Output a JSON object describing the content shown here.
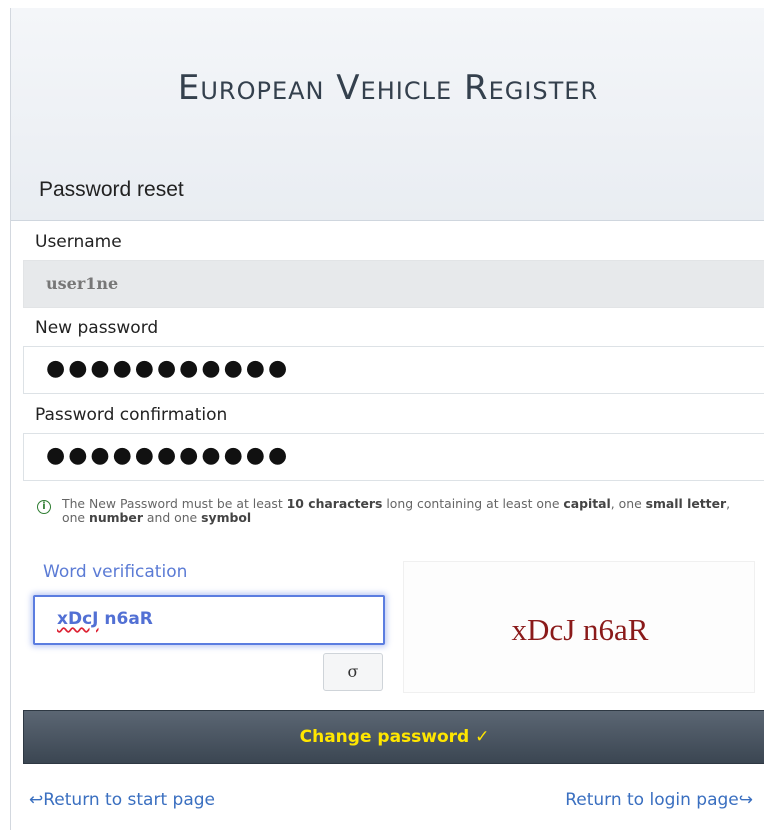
{
  "header": {
    "site_title": "European Vehicle Register"
  },
  "form": {
    "title": "Password reset",
    "username": {
      "label": "Username",
      "value": "user1ne"
    },
    "new_password": {
      "label": "New password",
      "masked_value": "●●●●●●●●●●●"
    },
    "password_confirmation": {
      "label": "Password confirmation",
      "masked_value": "●●●●●●●●●●●"
    },
    "info": {
      "icon": "info-circle-icon",
      "text_1": "The New Password must be at least ",
      "bold_1": "10 characters",
      "text_2": " long containing at least one ",
      "bold_2": "capital",
      "text_3": ", one ",
      "bold_3": "small letter",
      "text_4": ", one ",
      "bold_4": "number",
      "text_5": " and one ",
      "bold_5": "symbol"
    },
    "verification": {
      "label": "Word verification",
      "input_value_part1": "xDcJ",
      "input_value_part2": " n6aR",
      "captcha_text": "xDcJ n6aR",
      "refresh_symbol": "σ",
      "refresh_icon": "refresh-icon"
    },
    "submit_label": "Change password ✓"
  },
  "footer": {
    "start_link": "↩Return to start page",
    "login_link": "Return to login page↪"
  },
  "colors": {
    "submit_text": "#ffe600",
    "link": "#3a6fc0",
    "captcha_text": "#8a1a1a",
    "focus_border": "#5b7de0"
  }
}
